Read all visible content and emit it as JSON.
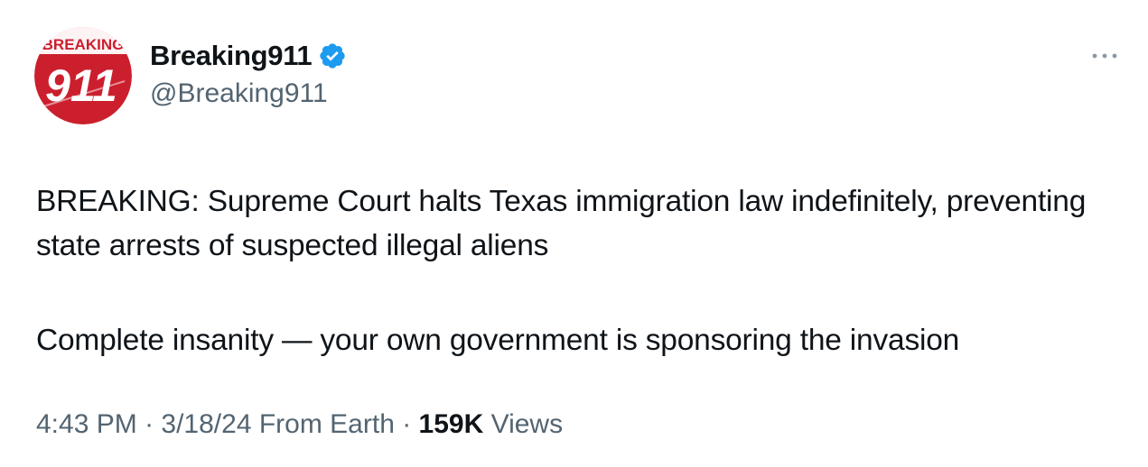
{
  "author": {
    "display_name": "Breaking911",
    "handle": "@Breaking911",
    "verified": true,
    "avatar": {
      "text_top": "BREAKING",
      "text_main": "911",
      "bg_color": "#cc1f2e"
    },
    "verified_color": "#1d9bf0"
  },
  "tweet": {
    "paragraph_1": "BREAKING: Supreme Court halts Texas immigration law indefinitely, preventing state arrests of suspected illegal aliens",
    "paragraph_2": "Complete insanity — your own government is sponsoring the invasion"
  },
  "meta": {
    "time": "4:43 PM",
    "separator": " · ",
    "date": "3/18/24",
    "source": "From Earth",
    "views_count": "159K",
    "views_label": "Views"
  },
  "icons": {
    "more": "more-horizontal-icon",
    "verified": "verified-badge-icon"
  }
}
